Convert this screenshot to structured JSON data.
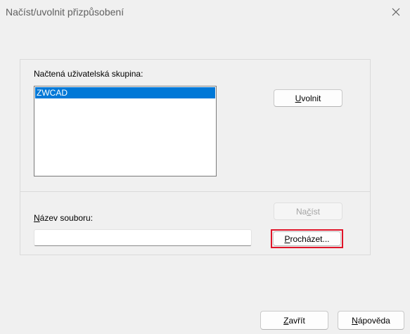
{
  "window": {
    "title": "Načíst/uvolnit přizpůsobení"
  },
  "loaded_group": {
    "label": "Načtená uživatelská skupina:",
    "items": [
      "ZWCAD"
    ],
    "selected_index": 0
  },
  "buttons": {
    "unload": {
      "pre": "",
      "key": "U",
      "post": "volnit"
    },
    "load": {
      "pre": "Na",
      "key": "č",
      "post": "íst",
      "disabled": true
    },
    "browse": {
      "pre": "",
      "key": "P",
      "post": "rocházet..."
    },
    "close": {
      "pre": "",
      "key": "Z",
      "post": "avřít"
    },
    "help": {
      "pre": "",
      "key": "N",
      "post": "ápověda"
    }
  },
  "filename": {
    "label_key": "N",
    "label_rest": "ázev souboru:",
    "value": "",
    "placeholder": ""
  },
  "icons": {
    "close": "close-icon"
  },
  "colors": {
    "selection": "#0078d7",
    "focus_ring": "#e0152a"
  }
}
